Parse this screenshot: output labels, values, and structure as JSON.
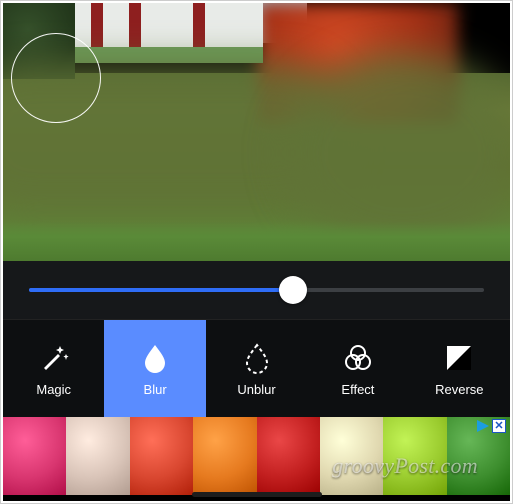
{
  "slider": {
    "value": 58,
    "min": 0,
    "max": 100
  },
  "tools": [
    {
      "id": "magic",
      "label": "Magic",
      "active": false
    },
    {
      "id": "blur",
      "label": "Blur",
      "active": true
    },
    {
      "id": "unblur",
      "label": "Unblur",
      "active": false
    },
    {
      "id": "effect",
      "label": "Effect",
      "active": false
    },
    {
      "id": "reverse",
      "label": "Reverse",
      "active": false
    }
  ],
  "ad_swatches": [
    "#d93670",
    "#d9c4b8",
    "#d94730",
    "#e67a1f",
    "#c21f1f",
    "#e0d8b0",
    "#9acb2e",
    "#3e8f2f"
  ],
  "watermark": "groovyPost.com",
  "colors": {
    "accent": "#5a8cff",
    "slider_fill": "#2f6df6"
  }
}
